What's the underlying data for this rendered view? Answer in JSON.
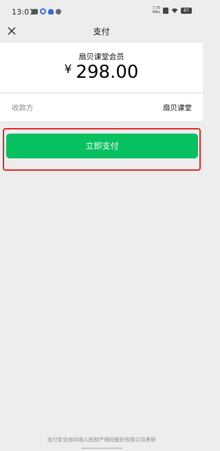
{
  "status_bar": {
    "time": "13:01",
    "net_speed_value": "7.70",
    "net_speed_unit": "KB/s",
    "battery": "87"
  },
  "nav": {
    "title": "支付",
    "close_icon": "close-icon"
  },
  "payment": {
    "product_name": "扇贝课堂会员",
    "currency_symbol": "¥",
    "amount": "298.00",
    "payee_label": "收款方",
    "payee_value": "扇贝课堂",
    "pay_button_label": "立即支付"
  },
  "footer": {
    "text": "支付安全由中国人民财产保险股份有限公司承保"
  },
  "colors": {
    "background": "#ededed",
    "card": "#ffffff",
    "primary_button": "#07c160",
    "highlight_border": "#e8221f"
  }
}
